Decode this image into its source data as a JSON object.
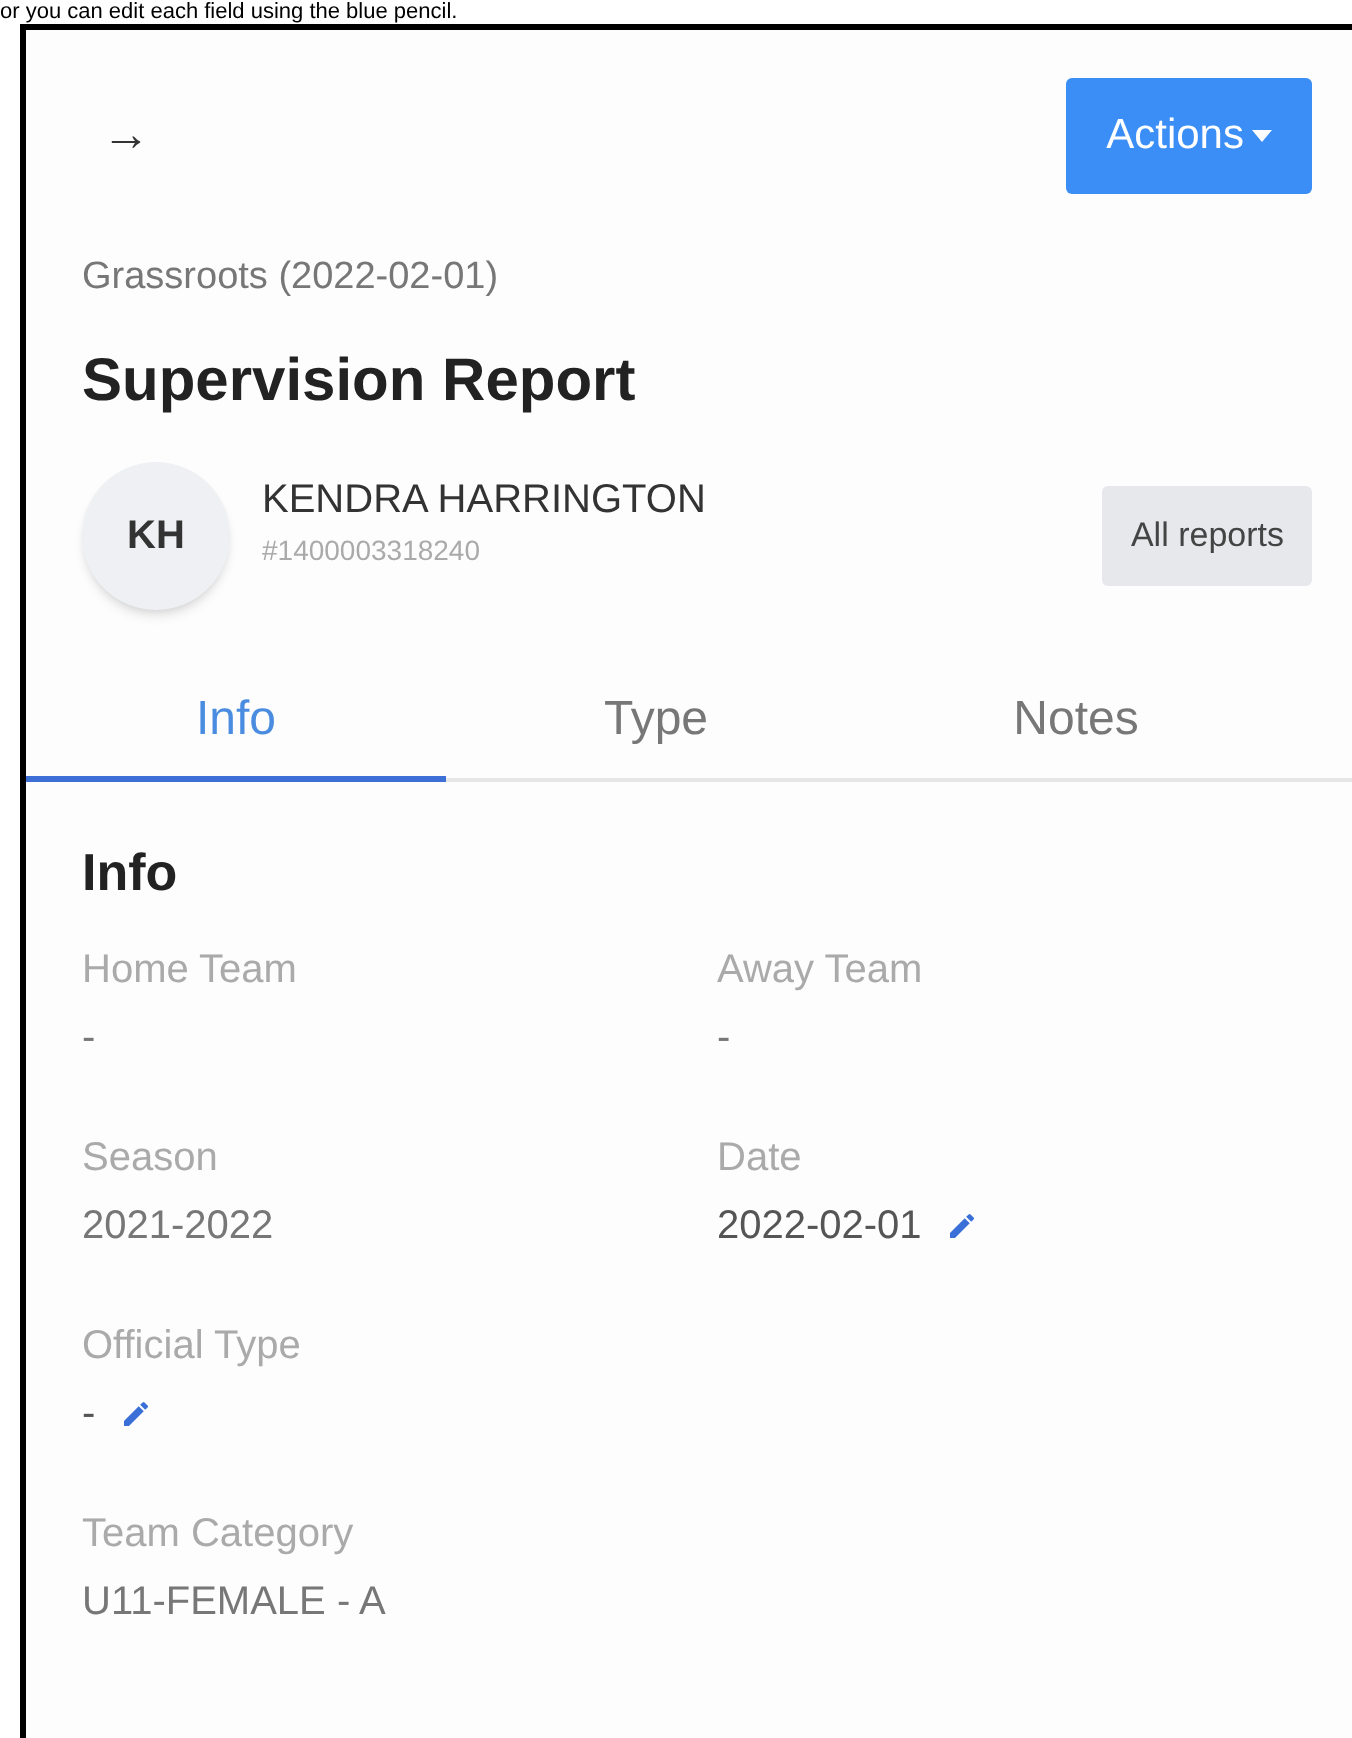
{
  "caption": "or you can edit each field using the blue pencil.",
  "header": {
    "back_icon": "→",
    "actions_button": "Actions"
  },
  "subtitle": "Grassroots (2022-02-01)",
  "title": "Supervision Report",
  "person": {
    "initials": "KH",
    "name": "KENDRA HARRINGTON",
    "id": "#1400003318240",
    "reports_button": "All reports"
  },
  "tabs": [
    {
      "label": "Info",
      "selected": true
    },
    {
      "label": "Type",
      "selected": false
    },
    {
      "label": "Notes",
      "selected": false
    }
  ],
  "section_title": "Info",
  "field_rows": [
    [
      {
        "label": "Home Team",
        "value": "-",
        "editable": false
      },
      {
        "label": "Away Team",
        "value": "-",
        "editable": false
      }
    ],
    [
      {
        "label": "Season",
        "value": "2021-2022",
        "editable": false
      },
      {
        "label": "Date",
        "value": "2022-02-01",
        "editable": true
      }
    ],
    [
      {
        "label": "Official Type",
        "value": "-",
        "editable": true
      }
    ],
    [
      {
        "label": "Team Category",
        "value": "U11-FEMALE - A",
        "editable": false
      }
    ]
  ]
}
